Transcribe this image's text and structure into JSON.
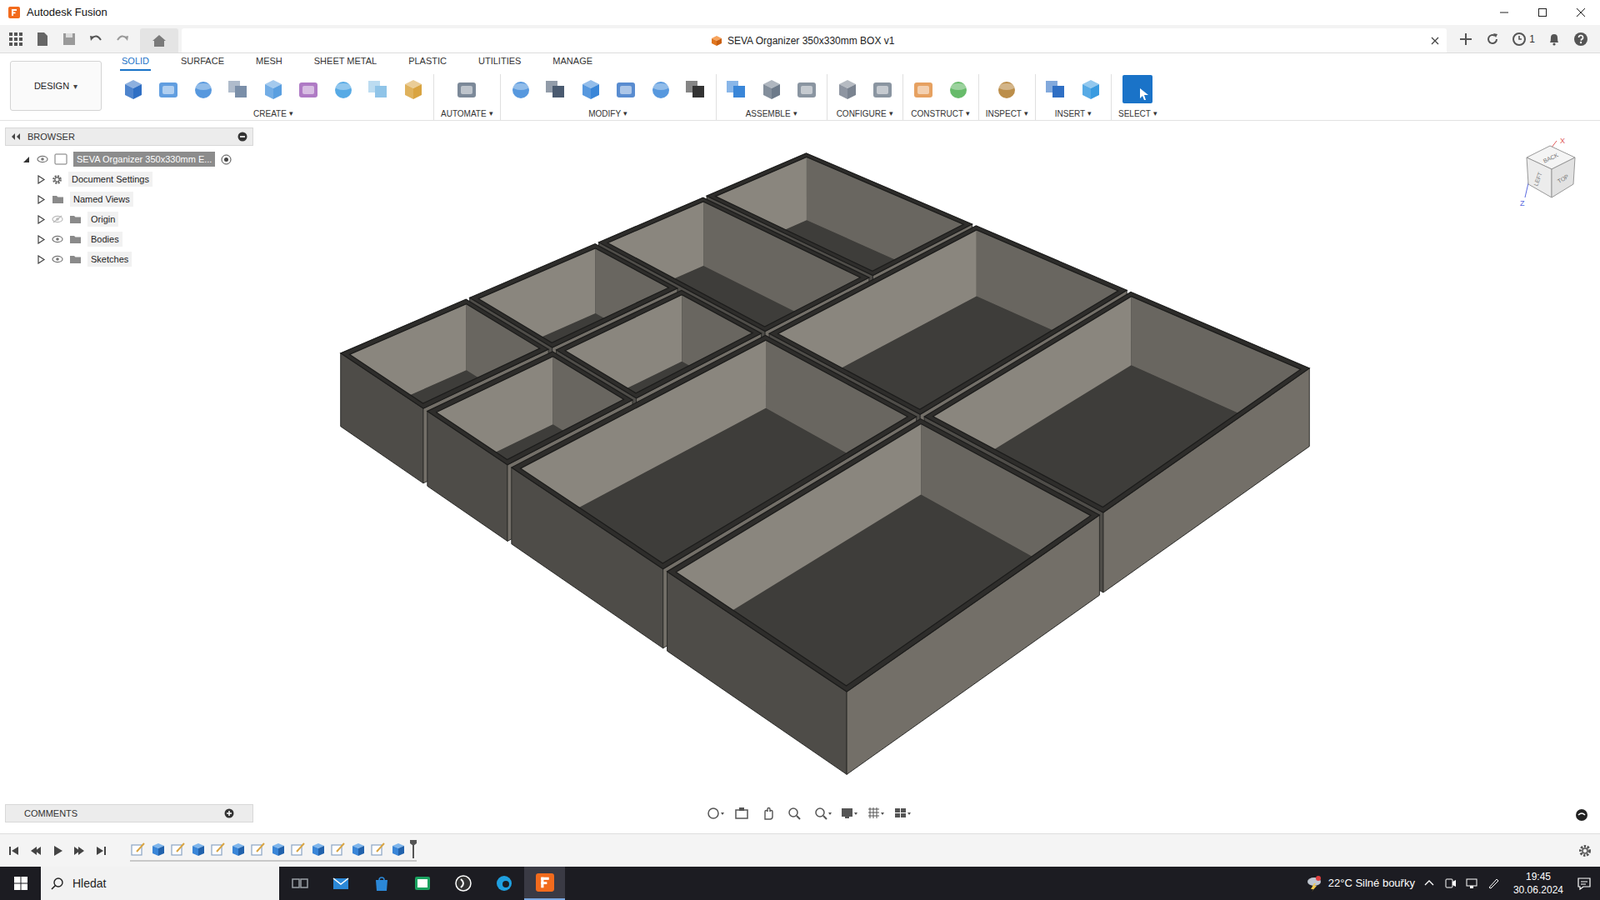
{
  "window": {
    "title": "Autodesk Fusion"
  },
  "document_tab": {
    "title": "SEVA Organizer 350x330mm BOX v1",
    "job_count": "1"
  },
  "workspace": {
    "label": "DESIGN"
  },
  "menu_caret": "▾",
  "toolbar_tabs": [
    {
      "label": "SOLID",
      "selected": true
    },
    {
      "label": "SURFACE",
      "selected": false
    },
    {
      "label": "MESH",
      "selected": false
    },
    {
      "label": "SHEET METAL",
      "selected": false
    },
    {
      "label": "PLASTIC",
      "selected": false
    },
    {
      "label": "UTILITIES",
      "selected": false
    },
    {
      "label": "MANAGE",
      "selected": false
    }
  ],
  "toolbar_groups": [
    {
      "label": "CREATE"
    },
    {
      "label": "AUTOMATE"
    },
    {
      "label": "MODIFY"
    },
    {
      "label": "ASSEMBLE"
    },
    {
      "label": "CONFIGURE"
    },
    {
      "label": "CONSTRUCT"
    },
    {
      "label": "INSPECT"
    },
    {
      "label": "INSERT"
    },
    {
      "label": "SELECT"
    }
  ],
  "browser": {
    "title": "BROWSER",
    "root": {
      "label": "SEVA Organizer 350x330mm E...",
      "expanded": true,
      "visible": true
    },
    "items": [
      {
        "label": "Document Settings",
        "kind": "settings",
        "eye": "none",
        "expanded": false
      },
      {
        "label": "Named Views",
        "kind": "folder",
        "eye": "none",
        "expanded": false
      },
      {
        "label": "Origin",
        "kind": "folder",
        "eye": "hidden",
        "expanded": false
      },
      {
        "label": "Bodies",
        "kind": "folder",
        "eye": "shown",
        "expanded": false
      },
      {
        "label": "Sketches",
        "kind": "folder",
        "eye": "shown",
        "expanded": false
      }
    ]
  },
  "comments": {
    "title": "COMMENTS"
  },
  "viewcube": {
    "faces": [
      "BACK",
      "LEFT",
      "TOP"
    ],
    "axes": [
      "X",
      "Z"
    ]
  },
  "timeline": {
    "features": [
      {
        "kind": "sketch"
      },
      {
        "kind": "extrude"
      },
      {
        "kind": "sketch"
      },
      {
        "kind": "extrude"
      },
      {
        "kind": "sketch"
      },
      {
        "kind": "extrude"
      },
      {
        "kind": "sketch"
      },
      {
        "kind": "extrude"
      },
      {
        "kind": "sketch"
      },
      {
        "kind": "extrude"
      },
      {
        "kind": "sketch"
      },
      {
        "kind": "extrude"
      },
      {
        "kind": "sketch"
      },
      {
        "kind": "extrude"
      }
    ]
  },
  "taskbar": {
    "search_placeholder": "Hledat",
    "weather": "22°C Silné bouřky",
    "time": "19:45",
    "date": "30.06.2024"
  }
}
